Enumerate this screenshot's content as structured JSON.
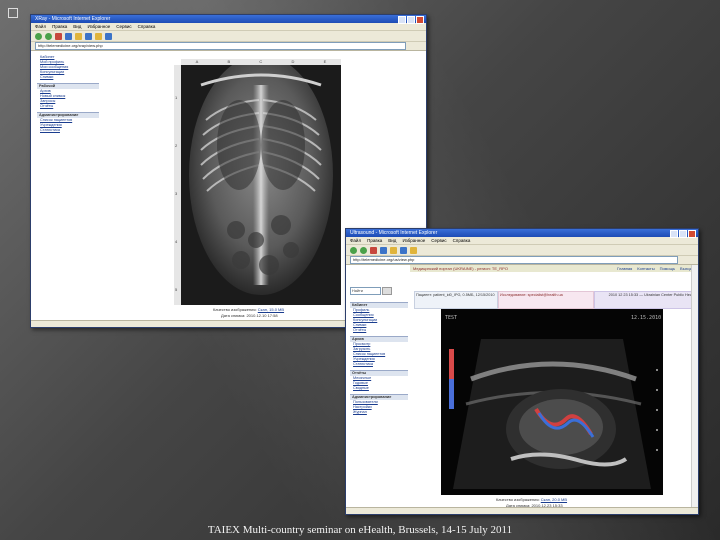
{
  "window1": {
    "title": "XRay - Microsoft Internet Explorer",
    "menu": [
      "Файл",
      "Правка",
      "Вид",
      "Избранное",
      "Сервис",
      "Справка"
    ],
    "address": "http://telemedicine.org/xray/view.php",
    "sidebar": {
      "items_top": [
        "Кабинет",
        "Мой профиль",
        "Мои сообщения",
        "Консультации",
        "Снимки"
      ],
      "section1": "Рабочий",
      "items_mid": [
        "Архив",
        "Новый снимок",
        "Запросы",
        "Отчёты"
      ],
      "section2": "Администрирование",
      "items_bot": [
        "Список пациентов",
        "Учреждения",
        "Статистика"
      ]
    },
    "ruler_top": [
      "A",
      "B",
      "C",
      "D",
      "E"
    ],
    "ruler_side": [
      "1",
      "2",
      "3",
      "4",
      "5"
    ],
    "caption_label": "Качество изображения:",
    "caption_link": "Скан, 15.0 MB",
    "caption_date": "Дата снимка: 2010.12.10 17:58"
  },
  "window2": {
    "title": "Ultrasound - Microsoft Internet Explorer",
    "menu": [
      "Файл",
      "Правка",
      "Вид",
      "Избранное",
      "Сервис",
      "Справка"
    ],
    "address": "http://telemedicine.org/us/view.php",
    "header": "Медицинский портал (UKRAINE) - регион: TE_RPO",
    "nav": [
      "Главная",
      "Контакты",
      "Помощь",
      "Выход"
    ],
    "search_value": "Найти",
    "sidebar": {
      "section0": "Кабинет",
      "items0": [
        "Профиль",
        "Сообщения",
        "Консультации",
        "Снимки",
        "Отчёты"
      ],
      "section1": "Архив",
      "items1": [
        "Просмотр",
        "Загрузить",
        "Список пациентов",
        "Учреждения",
        "Статистика"
      ],
      "section2": "Отчёты",
      "items2": [
        "Месячные",
        "Годовые",
        "Сводные"
      ],
      "section3": "Администрирование",
      "items3": [
        "Пользователи",
        "Настройки",
        "Журнал"
      ]
    },
    "info_a": "Пациент: patient_id0_IPG, 0.5МБ, 12/15/2010",
    "info_b": "Исследование: specialist@health.ua",
    "info_c": "2010 12 23 15:33 — Ukrainian Center Public Health",
    "caption_label": "Качество изображения:",
    "caption_link": "Скан, 20.0 MB",
    "caption_date": "Дата снимка: 2010.12.23 15:33"
  },
  "footer": "TAIEX Multi-country seminar on eHealth, Brussels, 14-15 July 2011",
  "colors": {
    "titlebar": "#1c4bb5",
    "link": "#1a3d8f",
    "background": "#454545"
  }
}
